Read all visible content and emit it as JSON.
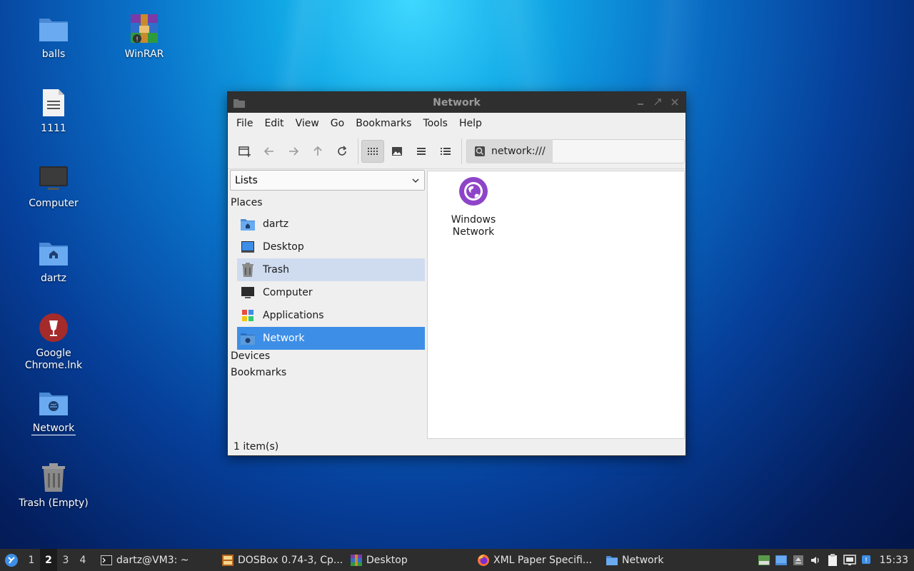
{
  "desktop": {
    "icons": [
      {
        "label": "balls"
      },
      {
        "label": "WinRAR"
      },
      {
        "label": "1111"
      },
      {
        "label": "Computer"
      },
      {
        "label": "dartz"
      },
      {
        "label": "Google Chrome.lnk"
      },
      {
        "label": "Network"
      },
      {
        "label": "Trash (Empty)"
      }
    ]
  },
  "window": {
    "title": "Network",
    "menu": [
      "File",
      "Edit",
      "View",
      "Go",
      "Bookmarks",
      "Tools",
      "Help"
    ],
    "location": "network:///",
    "side_combo": "Lists",
    "sections": {
      "places": "Places",
      "devices": "Devices",
      "bookmarks": "Bookmarks"
    },
    "places": [
      "dartz",
      "Desktop",
      "Trash",
      "Computer",
      "Applications",
      "Network"
    ],
    "files": [
      {
        "label": "Windows Network"
      }
    ],
    "status": "1 item(s)"
  },
  "taskbar": {
    "workspaces": [
      "1",
      "2",
      "3",
      "4"
    ],
    "active_workspace": "2",
    "tasks": [
      "dartz@VM3: ~",
      "DOSBox 0.74-3, Cp...",
      "Desktop",
      "XML Paper Specifi...",
      "Network"
    ],
    "clock": "15:33"
  },
  "colors": {
    "selection": "#3d8ee6",
    "hover": "#cfdcf0",
    "accent_purple": "#8e44c8",
    "folder_blue": "#5b9bdc"
  }
}
